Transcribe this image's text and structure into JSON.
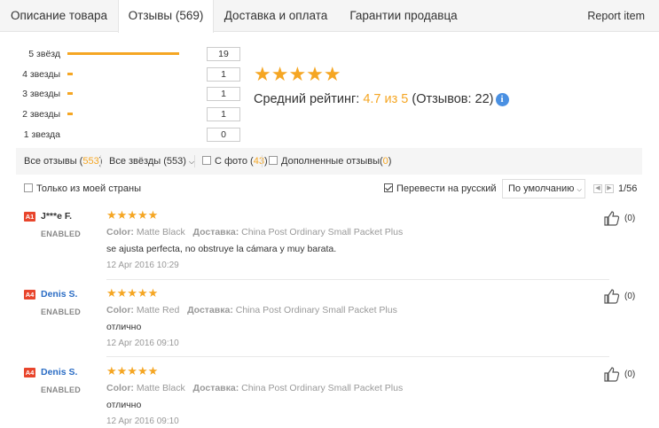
{
  "tabs": [
    {
      "label": "Описание товара"
    },
    {
      "label": "Отзывы (569)"
    },
    {
      "label": "Доставка и оплата"
    },
    {
      "label": "Гарантии продавца"
    }
  ],
  "report_label": "Report item",
  "histogram": [
    {
      "label": "5 звёзд",
      "count": "19",
      "fraction": 0.86
    },
    {
      "label": "4 звезды",
      "count": "1",
      "fraction": 0.04
    },
    {
      "label": "3 звезды",
      "count": "1",
      "fraction": 0.04
    },
    {
      "label": "2 звезды",
      "count": "1",
      "fraction": 0.04
    },
    {
      "label": "1 звезда",
      "count": "0",
      "fraction": 0
    }
  ],
  "summary": {
    "stars": "★★★★★",
    "avg_label": "Средний рейтинг:",
    "avg_value": "4.7 из 5",
    "reviews_count": "(Отзывов: 22)",
    "info_glyph": "i"
  },
  "filters": {
    "all_reviews": "Все отзывы",
    "all_reviews_count": "553",
    "all_stars": "Все звёзды (553)",
    "with_photo": "С фото",
    "with_photo_count": "43",
    "additional": "Дополненные отзывы",
    "additional_count": "0"
  },
  "options": {
    "my_country": "Только из моей страны",
    "translate": "Перевести на русский",
    "sort": "По умолчанию",
    "page": "1/56"
  },
  "reviews": [
    {
      "badge": "A1",
      "name": "J***e F.",
      "status": "ENABLED",
      "stars": "★★★★★",
      "color_key": "Color:",
      "color_val": "Matte Black",
      "ship_key": "Доставка:",
      "ship_val": "China Post Ordinary Small Packet Plus",
      "text": "se ajusta perfecta, no obstruye la cámara y muy barata.",
      "date": "12 Apr 2016 10:29",
      "likes": "(0)"
    },
    {
      "badge": "A4",
      "name": "Denis S.",
      "status": "ENABLED",
      "stars": "★★★★★",
      "color_key": "Color:",
      "color_val": "Matte Red",
      "ship_key": "Доставка:",
      "ship_val": "China Post Ordinary Small Packet Plus",
      "text": "отлично",
      "date": "12 Apr 2016 09:10",
      "likes": "(0)"
    },
    {
      "badge": "A4",
      "name": "Denis S.",
      "status": "ENABLED",
      "stars": "★★★★★",
      "color_key": "Color:",
      "color_val": "Matte Black",
      "ship_key": "Доставка:",
      "ship_val": "China Post Ordinary Small Packet Plus",
      "text": "отлично",
      "date": "12 Apr 2016 09:10",
      "likes": "(0)"
    }
  ],
  "colors": {
    "accent": "#f5a623",
    "badge": "#e8452c",
    "link": "#2a6cc4"
  }
}
